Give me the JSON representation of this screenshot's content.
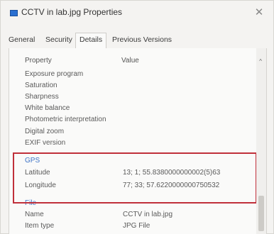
{
  "window": {
    "title": "CCTV in lab.jpg Properties",
    "close_symbol": "✕"
  },
  "tabs": [
    {
      "label": "General"
    },
    {
      "label": "Security"
    },
    {
      "label": "Details"
    },
    {
      "label": "Previous Versions"
    }
  ],
  "active_tab": "Details",
  "list": {
    "header_property": "Property",
    "header_value": "Value",
    "sort_arrow": "^",
    "rows_before": [
      {
        "property": "Exposure program",
        "value": ""
      },
      {
        "property": "Saturation",
        "value": ""
      },
      {
        "property": "Sharpness",
        "value": ""
      },
      {
        "property": "White balance",
        "value": ""
      },
      {
        "property": "Photometric interpretation",
        "value": ""
      },
      {
        "property": "Digital zoom",
        "value": ""
      },
      {
        "property": "EXIF version",
        "value": ""
      }
    ],
    "gps_group": "GPS",
    "gps_rows": [
      {
        "property": "Latitude",
        "value": "13; 1; 55.8380000000002(5)63"
      },
      {
        "property": "Longitude",
        "value": "77; 33; 57.6220000000750532"
      }
    ],
    "file_group": "File",
    "file_rows": [
      {
        "property": "Name",
        "value": "CCTV in lab.jpg"
      },
      {
        "property": "Item type",
        "value": "JPG File"
      }
    ]
  },
  "colors": {
    "highlight_border": "#c0303a",
    "group_header": "#3d73c6"
  }
}
